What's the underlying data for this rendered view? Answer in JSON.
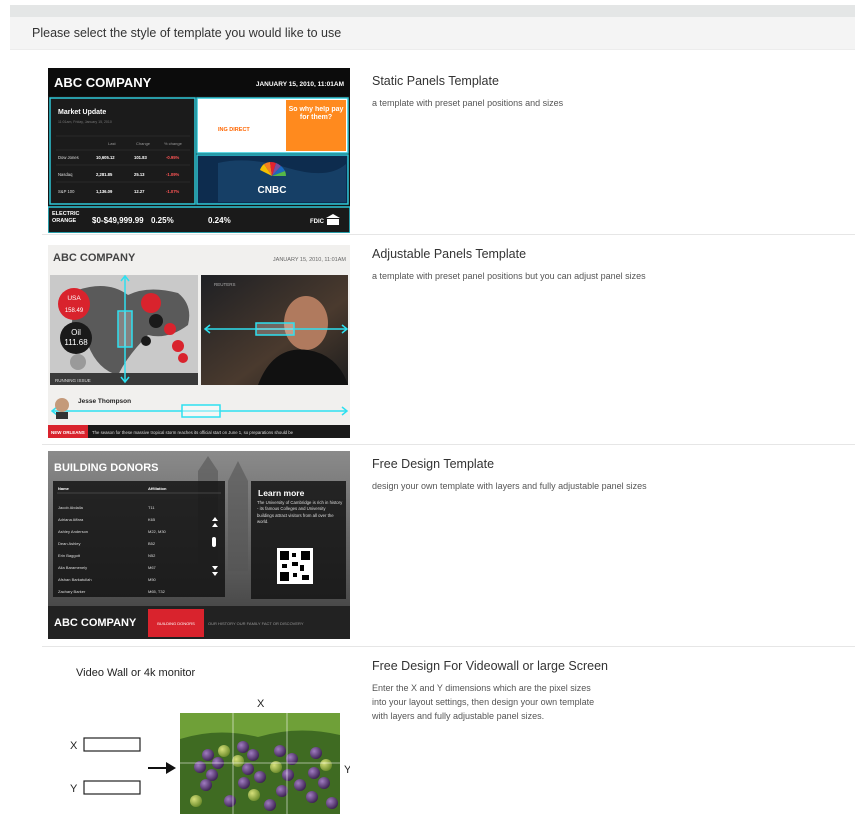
{
  "header": {
    "prompt": "Please select the style of template you would like to use"
  },
  "templates": [
    {
      "title": "Static Panels Template",
      "description": "a template with preset panel positions and sizes",
      "thumb": {
        "company": "ABC COMPANY",
        "datetime": "JANUARY 15, 2010, 11:01AM",
        "market_title": "Market Update",
        "market_sub": "11:01am, Friday, January 15, 2010",
        "market_cols": [
          "Last",
          "Change",
          "% change"
        ],
        "market_rows": [
          [
            "Dow Jones",
            "10,605.12",
            "101.83",
            "-0.95%"
          ],
          [
            "Nasdaq",
            "2,281.85",
            "25.13",
            "-1.09%"
          ],
          [
            "S&P 100",
            "1,136.09",
            "12.27",
            "-1.07%"
          ]
        ],
        "ad_brand": "ING DIRECT",
        "ad_text": "So why help pay for them?",
        "news_logo": "CNBC",
        "ticker_brand": "ELECTRIC ORANGE",
        "ticker_amount": "$0-$49,999.99",
        "ticker_rate1": "0.25%",
        "ticker_rate2": "0.24%",
        "ticker_fdic": "FDIC"
      }
    },
    {
      "title": "Adjustable Panels Template",
      "description": "a template with preset panel positions but you can adjust panel sizes",
      "thumb": {
        "company": "ABC COMPANY",
        "datetime": "JANUARY 15, 2010, 11:01AM",
        "usa_label": "USA",
        "usa_value": "158.49",
        "oil_label": "Oil",
        "oil_value": "111.68",
        "map_caption": "RUNNING ISSUE",
        "photo_source": "REUTERS",
        "person_name": "Jesse Thompson",
        "ticker_tag": "NEW ORLEANS",
        "ticker_text": "The season for these massive tropical storm reaches its official start on June 1, so preparations should be"
      }
    },
    {
      "title": "Free Design Template",
      "description": "design your own template with layers and fully adjustable panel sizes",
      "thumb": {
        "heading": "BUILDING DONORS",
        "col_name": "Name",
        "col_affiliation": "Affiliation",
        "donors": [
          [
            "Jacob Abdalla",
            "T11"
          ],
          [
            "Adriana Affara",
            "K65"
          ],
          [
            "Ashley Anderson",
            "M22, M30"
          ],
          [
            "Dean Ashley",
            "B52"
          ],
          [
            "Erin Baggott",
            "N52"
          ],
          [
            "Alia Baramenely",
            "M67"
          ],
          [
            "Afshan Barkatullah",
            "M50"
          ],
          [
            "Zachary Barker",
            "M65, T32"
          ]
        ],
        "learn_title": "Learn more",
        "learn_text": "The University of Cambridge is rich in history - its famous Colleges and University buildings attract visitors from all over the world.",
        "company": "ABC COMPANY",
        "tab_active": "BUILDING DONORS",
        "tabs_inactive": "OUR HISTORY   OUR FAMILY   FACT OR DISCOVERY"
      }
    },
    {
      "title": "Free Design For Videowall or large Screen",
      "description": "Enter the X and Y dimensions which are the pixel sizes\ninto your layout settings, then design your own template\nwith layers and fully adjustable panel sizes.",
      "thumb": {
        "caption": "Video Wall or 4k monitor",
        "x_label": "X",
        "y_label": "Y"
      }
    }
  ]
}
